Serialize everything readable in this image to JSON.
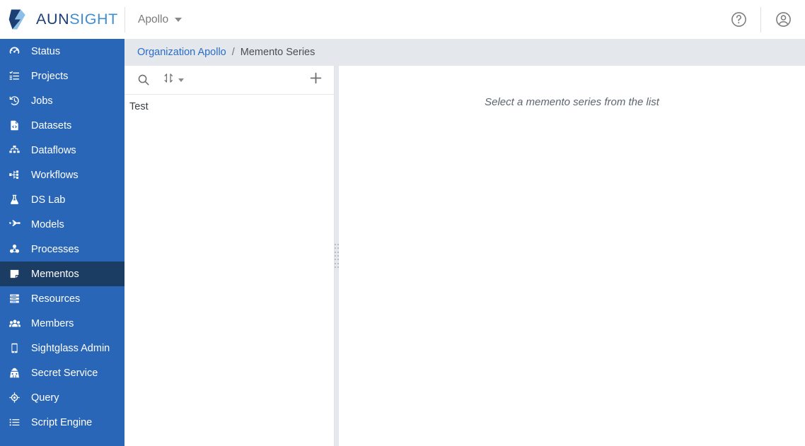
{
  "brand": {
    "name_part1": "AUN",
    "name_part2": "SIGHT",
    "logo_icon": "aunsight-logo-icon",
    "color_dark": "#1b3f73",
    "color_light": "#3f8ed0"
  },
  "topbar": {
    "org_label": "Apollo",
    "org_caret_icon": "chevron-down-icon",
    "help_icon": "help-circle-icon",
    "account_icon": "user-circle-icon"
  },
  "sidebar": {
    "background": "#2a66b7",
    "active_background": "#1c3d63",
    "items": [
      {
        "label": "Status",
        "icon": "gauge-icon"
      },
      {
        "label": "Projects",
        "icon": "tasks-list-icon"
      },
      {
        "label": "Jobs",
        "icon": "history-clock-icon"
      },
      {
        "label": "Datasets",
        "icon": "file-code-icon"
      },
      {
        "label": "Dataflows",
        "icon": "sitemap-icon"
      },
      {
        "label": "Workflows",
        "icon": "project-diagram-icon"
      },
      {
        "label": "DS Lab",
        "icon": "flask-icon"
      },
      {
        "label": "Models",
        "icon": "plane-icon"
      },
      {
        "label": "Processes",
        "icon": "cubes-icon"
      },
      {
        "label": "Mementos",
        "icon": "sticky-note-icon",
        "active": true
      },
      {
        "label": "Resources",
        "icon": "server-icon"
      },
      {
        "label": "Members",
        "icon": "users-icon"
      },
      {
        "label": "Sightglass Admin",
        "icon": "tablet-icon"
      },
      {
        "label": "Secret Service",
        "icon": "user-secret-icon"
      },
      {
        "label": "Query",
        "icon": "crosshairs-icon"
      },
      {
        "label": "Script Engine",
        "icon": "list-icon"
      }
    ]
  },
  "breadcrumb": {
    "link_label": "Organization Apollo",
    "separator": "/",
    "current_label": "Memento Series"
  },
  "list_panel": {
    "toolbar": {
      "search_icon": "search-icon",
      "sort_icon": "sort-icon",
      "sort_caret_icon": "chevron-down-icon",
      "add_icon": "plus-icon"
    },
    "rows": [
      {
        "label": "Test"
      }
    ]
  },
  "splitter": {
    "handle_icon": "drag-grip-icon"
  },
  "main": {
    "empty_message": "Select a memento series from the list"
  }
}
